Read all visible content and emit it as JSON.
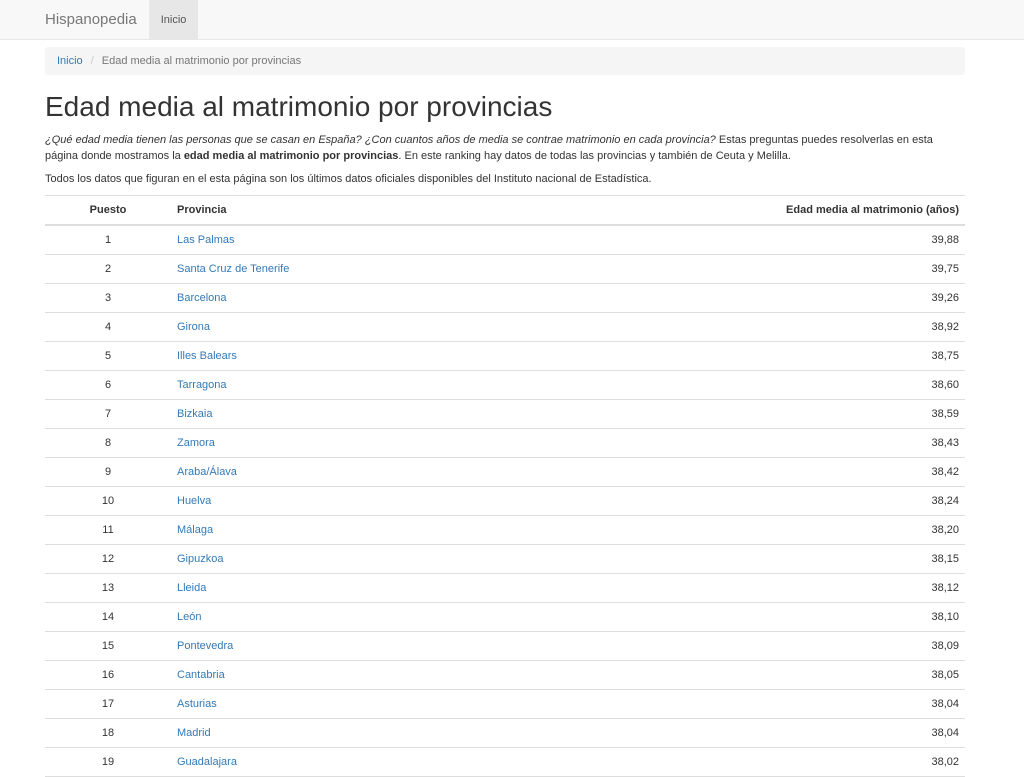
{
  "navbar": {
    "brand": "Hispanopedia",
    "active_item": "Inicio"
  },
  "breadcrumb": {
    "home": "Inicio",
    "separator": "/",
    "current": "Edad media al matrimonio por provincias"
  },
  "page": {
    "title": "Edad media al matrimonio por provincias",
    "intro_question": "¿Qué edad media tienen las personas que se casan en España? ¿Con cuantos años de media se contrae matrimonio en cada provincia?",
    "intro_text_1": " Estas preguntas puedes resolverlas en esta página donde mostramos la ",
    "intro_bold": "edad media al matrimonio por provincias",
    "intro_text_2": ". En este ranking hay datos de todas las provincias y también de Ceuta y Melilla.",
    "note": "Todos los datos que figuran en el esta página son los últimos datos oficiales disponibles del Instituto nacional de Estadística."
  },
  "table": {
    "headers": {
      "position": "Puesto",
      "province": "Provincia",
      "value": "Edad media al matrimonio (años)"
    },
    "rows": [
      {
        "pos": "1",
        "province": "Las Palmas",
        "value": "39,88"
      },
      {
        "pos": "2",
        "province": "Santa Cruz de Tenerife",
        "value": "39,75"
      },
      {
        "pos": "3",
        "province": "Barcelona",
        "value": "39,26"
      },
      {
        "pos": "4",
        "province": "Girona",
        "value": "38,92"
      },
      {
        "pos": "5",
        "province": "Illes Balears",
        "value": "38,75"
      },
      {
        "pos": "6",
        "province": "Tarragona",
        "value": "38,60"
      },
      {
        "pos": "7",
        "province": "Bizkaia",
        "value": "38,59"
      },
      {
        "pos": "8",
        "province": "Zamora",
        "value": "38,43"
      },
      {
        "pos": "9",
        "province": "Araba/Álava",
        "value": "38,42"
      },
      {
        "pos": "10",
        "province": "Huelva",
        "value": "38,24"
      },
      {
        "pos": "11",
        "province": "Málaga",
        "value": "38,20"
      },
      {
        "pos": "12",
        "province": "Gipuzkoa",
        "value": "38,15"
      },
      {
        "pos": "13",
        "province": "Lleida",
        "value": "38,12"
      },
      {
        "pos": "14",
        "province": "León",
        "value": "38,10"
      },
      {
        "pos": "15",
        "province": "Pontevedra",
        "value": "38,09"
      },
      {
        "pos": "16",
        "province": "Cantabria",
        "value": "38,05"
      },
      {
        "pos": "17",
        "province": "Asturias",
        "value": "38,04"
      },
      {
        "pos": "18",
        "province": "Madrid",
        "value": "38,04"
      },
      {
        "pos": "19",
        "province": "Guadalajara",
        "value": "38,02"
      }
    ]
  }
}
